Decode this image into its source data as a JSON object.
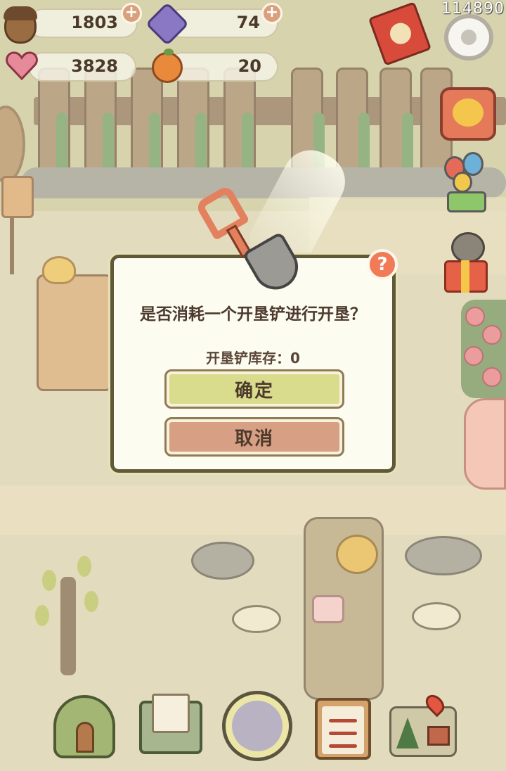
{
  "hud": {
    "score": "114890",
    "resources": [
      {
        "name": "acorn",
        "icon": "acorn-icon",
        "value": "1803",
        "has_plus": true
      },
      {
        "name": "gem",
        "icon": "purple-gem-icon",
        "value": "74",
        "has_plus": true
      },
      {
        "name": "heart",
        "icon": "heart-gem-icon",
        "value": "3828",
        "has_plus": false
      },
      {
        "name": "orange",
        "icon": "orange-icon",
        "value": "20",
        "has_plus": false
      }
    ],
    "plus_symbol": "+"
  },
  "side_buttons": [
    "red-envelope-icon",
    "settings-gear-icon",
    "tv-chick-icon",
    "balloons-gift-icon",
    "sloth-gift-icon"
  ],
  "dialog": {
    "title": "是否消耗一个开垦铲进行开垦？",
    "stock_label": "开垦铲库存：0",
    "confirm_label": "确定",
    "cancel_label": "取消",
    "help_symbol": "?"
  },
  "bottom_nav": [
    "house-icon",
    "mail-icon",
    "paw-icon",
    "task-clipboard-icon",
    "map-icon"
  ],
  "colors": {
    "dialog_border": "#5e5a37",
    "confirm_bg": "#d8dc8c",
    "cancel_bg": "#d79f83",
    "help_bg": "#f07b56"
  }
}
